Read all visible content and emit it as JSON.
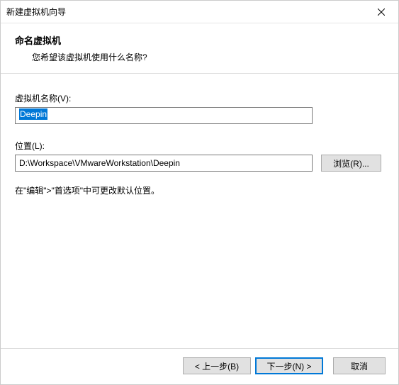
{
  "window": {
    "title": "新建虚拟机向导"
  },
  "header": {
    "title": "命名虚拟机",
    "subtitle": "您希望该虚拟机使用什么名称?"
  },
  "fields": {
    "name_label": "虚拟机名称(V):",
    "name_value": "Deepin",
    "location_label": "位置(L):",
    "location_value": "D:\\Workspace\\VMwareWorkstation\\Deepin",
    "browse_label": "浏览(R)..."
  },
  "hint": "在\"编辑\">\"首选项\"中可更改默认位置。",
  "footer": {
    "back": "< 上一步(B)",
    "next": "下一步(N) >",
    "cancel": "取消"
  }
}
